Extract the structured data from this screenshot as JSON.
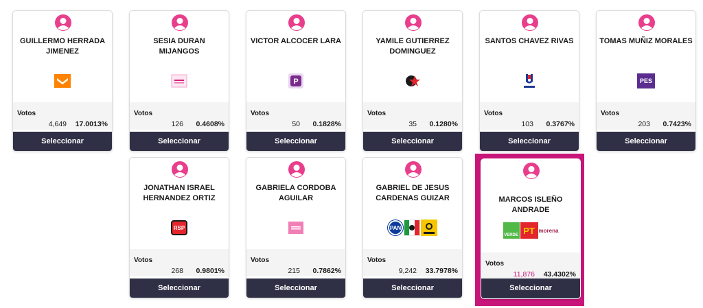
{
  "votos_label": "Votos",
  "select_label": "Seleccionar",
  "colors": {
    "accent": "#c8157a",
    "button": "#2f2f45",
    "stats_bg": "#f4f4f5"
  },
  "candidates": [
    {
      "name": "GUILLERMO HERRADA JIMENEZ",
      "votes": "4,649",
      "pct": "17.0013%",
      "party_icon": "movimiento-ciudadano-logo"
    },
    {
      "name": "SESIA DURAN MIJANGOS",
      "votes": "126",
      "pct": "0.4608%",
      "party_icon": "small-party-logo"
    },
    {
      "name": "VICTOR ALCOCER LARA",
      "votes": "50",
      "pct": "0.1828%",
      "party_icon": "p-party-logo"
    },
    {
      "name": "YAMILE GUTIERREZ DOMINGUEZ",
      "votes": "35",
      "pct": "0.1280%",
      "party_icon": "star-party-logo"
    },
    {
      "name": "SANTOS CHAVEZ RIVAS",
      "votes": "103",
      "pct": "0.3767%",
      "party_icon": "unidad-party-logo"
    },
    {
      "name": "TOMAS MUÑIZ MORALES",
      "votes": "203",
      "pct": "0.7423%",
      "party_icon": "pes-party-logo",
      "logo_text": "PES"
    },
    {
      "name": "JONATHAN ISRAEL HERNANDEZ ORTIZ",
      "votes": "268",
      "pct": "0.9801%",
      "party_icon": "rsp-party-logo",
      "logo_text": "RSP"
    },
    {
      "name": "GABRIELA CORDOBA AGUILAR",
      "votes": "215",
      "pct": "0.7862%",
      "party_icon": "pink-party-logo"
    },
    {
      "name": "GABRIEL DE JESUS CARDENAS GUIZAR",
      "votes": "9,242",
      "pct": "33.7978%",
      "party_icon": "pan-pri-prd-coalition-logo",
      "logo_text": "PAN"
    },
    {
      "name": "MARCOS ISLEÑO ANDRADE",
      "votes": "11,876",
      "pct": "43.4302%",
      "party_icon": "verde-pt-morena-coalition-logo",
      "logo_text": [
        "VERDE",
        "PT",
        "morena"
      ],
      "winner": true
    }
  ]
}
